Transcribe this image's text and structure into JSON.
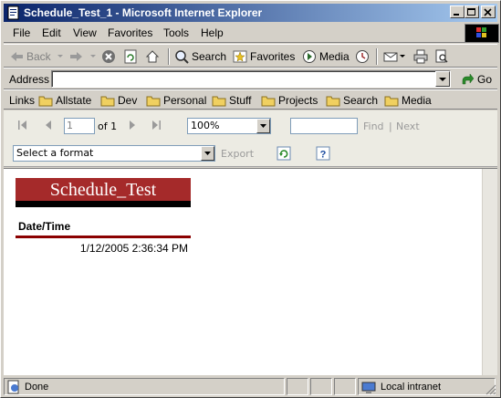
{
  "window": {
    "title": "Schedule_Test_1 - Microsoft Internet Explorer"
  },
  "menu": {
    "items": [
      "File",
      "Edit",
      "View",
      "Favorites",
      "Tools",
      "Help"
    ]
  },
  "toolbar": {
    "back_label": "Back",
    "search_label": "Search",
    "favorites_label": "Favorites",
    "media_label": "Media"
  },
  "address": {
    "label": "Address",
    "value": "",
    "go_label": "Go"
  },
  "links": {
    "label": "Links",
    "items": [
      "Allstate",
      "Dev",
      "Personal",
      "Stuff",
      "Projects",
      "Search",
      "Media"
    ]
  },
  "report_toolbar": {
    "page_value": "1",
    "page_of": "of 1",
    "zoom_value": "100%",
    "find_value": "",
    "find_label": "Find",
    "separator": "|",
    "next_label": "Next",
    "format_placeholder": "Select a format",
    "export_label": "Export"
  },
  "report": {
    "title": "Schedule_Test",
    "column_header": "Date/Time",
    "rows": [
      "1/12/2005 2:36:34 PM"
    ],
    "accent_color": "#a52a2a"
  },
  "status": {
    "text": "Done",
    "zone": "Local intranet"
  }
}
